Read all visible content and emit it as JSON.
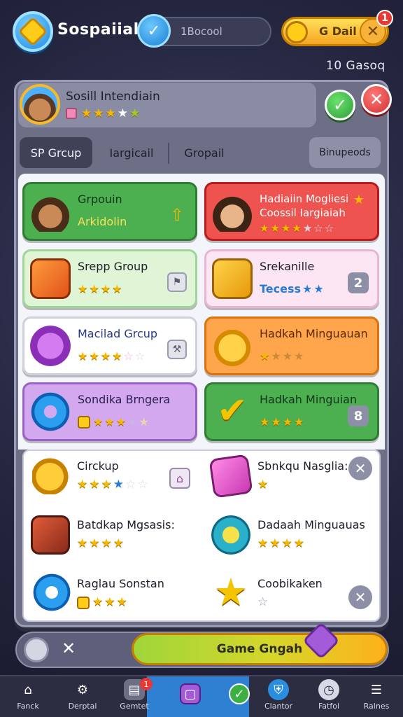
{
  "header": {
    "title": "Sospaiial",
    "search_value": "1Bocool",
    "gold_label": "G Dail",
    "notification_count": "1",
    "sub_count": "10 Gasoq"
  },
  "profile": {
    "name": "Sosill Intendiain",
    "rating_icons": [
      "badge",
      "on",
      "on",
      "on",
      "off",
      "on"
    ]
  },
  "tabs": [
    {
      "label": "SP Grcup",
      "active": true
    },
    {
      "label": "Iargicail",
      "active": false
    },
    {
      "label": "Gropail",
      "active": false
    },
    {
      "label": "Binupeods",
      "active": false
    }
  ],
  "cards": [
    {
      "title": "Grpouin",
      "subtitle": "Arkidolin",
      "color": "#4caf50",
      "border": "#2e7d32",
      "icon": "avatar-boy-icon",
      "extra": "arrow-up-icon"
    },
    {
      "title": "Hadiaiin Mogliesi",
      "subtitle": "Coossil Iargiaiah",
      "color": "#ef5350",
      "border": "#b71c1c",
      "icon": "avatar-girl-icon",
      "stars": [
        "on",
        "on",
        "on",
        "on",
        "off",
        "off",
        "off"
      ]
    },
    {
      "title": "Srepp Group",
      "color": "#dff5d6",
      "border": "#9fd49a",
      "icon": "box-icon",
      "stars": [
        "on",
        "on",
        "on",
        "on"
      ],
      "mini": "flag-icon"
    },
    {
      "title": "Srekanille",
      "subtitle": "Tecess",
      "color": "#fde6f3",
      "border": "#e9b6d2",
      "icon": "box-gold-icon",
      "badge": "2"
    },
    {
      "title": "Macilad Grcup",
      "color": "#ffffff",
      "border": "#cfd0de",
      "icon": "gem-purple-icon",
      "stars": [
        "on",
        "on",
        "on",
        "on",
        "off",
        "off"
      ],
      "mini": "tools-icon"
    },
    {
      "title": "Hadkah Minguauan",
      "color": "#ffa64d",
      "border": "#d9720f",
      "icon": "gold-blob-icon",
      "stars": [
        "on",
        "off",
        "off",
        "off"
      ]
    },
    {
      "title": "Sondika Brngera",
      "color": "#d3a8ef",
      "border": "#9a62c4",
      "icon": "ring-blue-icon",
      "stars": [
        "on",
        "on",
        "on",
        "on",
        "off",
        "off"
      ]
    },
    {
      "title": "Hadkah Minguian",
      "color": "#4caf50",
      "border": "#2e7d32",
      "icon": "check-gold-icon",
      "stars": [
        "on",
        "on",
        "on",
        "on"
      ],
      "badge": "8"
    }
  ],
  "list": [
    {
      "title": "Circkup",
      "icon": "gold-wing-icon",
      "stars": [
        "on",
        "on",
        "on",
        "blue",
        "off",
        "off"
      ],
      "mini": "home-icon"
    },
    {
      "title": "Sbnkqu Nasglia:",
      "icon": "pink-box-icon",
      "stars": [
        "on"
      ],
      "close": true
    },
    {
      "title": "Batdkap Mgsasis:",
      "icon": "gold-key-icon",
      "stars": [
        "on",
        "on",
        "on",
        "on"
      ]
    },
    {
      "title": "Dadaah Minguauas",
      "icon": "star-medal-icon",
      "stars": [
        "on",
        "on",
        "on",
        "on"
      ]
    },
    {
      "title": "Raglau Sonstan",
      "icon": "blue-ring-icon",
      "stars": [
        "on",
        "on",
        "on",
        "on"
      ]
    },
    {
      "title": "Coobikaken",
      "icon": "gold-star-icon",
      "stars": [
        "off"
      ],
      "close": true
    }
  ],
  "action": {
    "cta_label": "Game Gngah"
  },
  "nav": [
    {
      "label": "Fanck",
      "icon": "home-icon"
    },
    {
      "label": "Derptal",
      "icon": "gear-icon"
    },
    {
      "label": "Gemtet",
      "icon": "chest-icon",
      "badge": "1"
    },
    {
      "label": "",
      "icon": "purple-square-icon"
    },
    {
      "label": "",
      "icon": "check-circle-icon"
    },
    {
      "label": "Clantor",
      "icon": "shield-icon"
    },
    {
      "label": "Fatfol",
      "icon": "clock-icon"
    },
    {
      "label": "Ralnes",
      "icon": "menu-icon"
    }
  ],
  "colors": {
    "accent_blue": "#2f7fd2",
    "gold": "#f5b800",
    "green": "#4caf50",
    "red": "#e53935"
  }
}
